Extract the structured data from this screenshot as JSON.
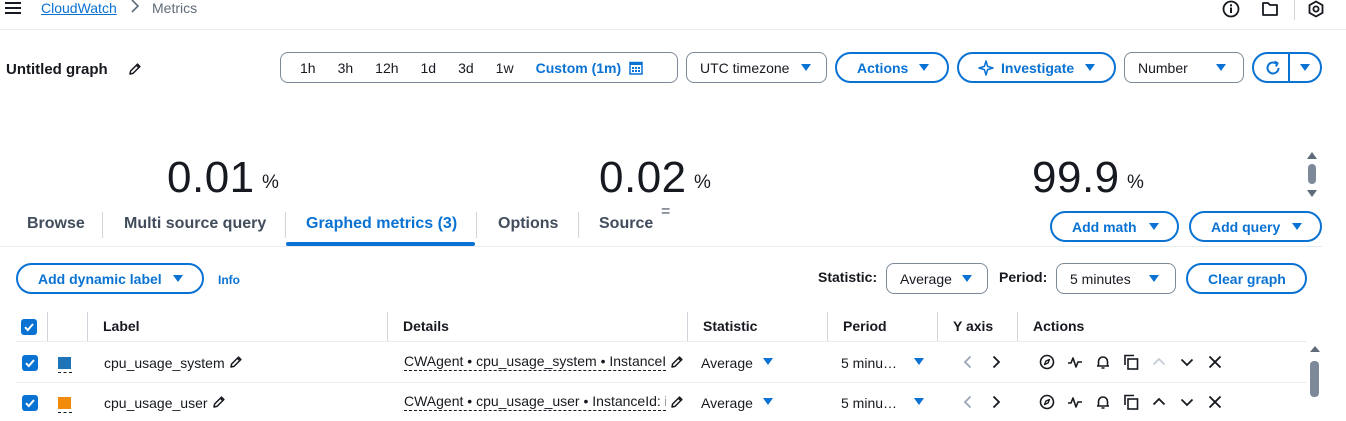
{
  "breadcrumb": {
    "service": "CloudWatch",
    "separator": ">",
    "current": "Metrics"
  },
  "top_icons": [
    "info-icon",
    "folder-icon",
    "settings-hex-icon"
  ],
  "header": {
    "title": "Untitled graph",
    "time_ranges": [
      "1h",
      "3h",
      "12h",
      "1d",
      "3d",
      "1w"
    ],
    "custom_range": "Custom (1m)",
    "timezone": "UTC timezone",
    "actions_label": "Actions",
    "investigate_label": "Investigate",
    "view_type": "Number"
  },
  "number_widgets": [
    {
      "value": "0.01",
      "unit": "%"
    },
    {
      "value": "0.02",
      "unit": "%"
    },
    {
      "value": "99.9",
      "unit": "%"
    }
  ],
  "tabs": [
    {
      "label": "Browse",
      "active": false
    },
    {
      "label": "Multi source query",
      "active": false
    },
    {
      "label": "Graphed metrics (3)",
      "active": true
    },
    {
      "label": "Options",
      "active": false
    },
    {
      "label": "Source",
      "active": false
    }
  ],
  "source_mark": "=",
  "math_buttons": {
    "add_math": "Add math",
    "add_query": "Add query"
  },
  "controls": {
    "add_dynamic_label": "Add dynamic label",
    "info": "Info",
    "statistic_label": "Statistic:",
    "statistic_value": "Average",
    "period_label": "Period:",
    "period_value": "5 minutes",
    "clear_graph": "Clear graph"
  },
  "table": {
    "columns": [
      "Label",
      "Details",
      "Statistic",
      "Period",
      "Y axis",
      "Actions"
    ],
    "rows": [
      {
        "label": "cpu_usage_system",
        "color": "#1f73b7",
        "details": "CWAgent • cpu_usage_system • InstanceId: i",
        "statistic": "Average",
        "period": "5 minu…"
      },
      {
        "label": "cpu_usage_user",
        "color": "#f28b0c",
        "details": "CWAgent • cpu_usage_user • InstanceId: i",
        "statistic": "Average",
        "period": "5 minu…"
      }
    ]
  },
  "colors": {
    "accent": "#0972d3",
    "text": "#16191f",
    "border": "#7d8998"
  }
}
